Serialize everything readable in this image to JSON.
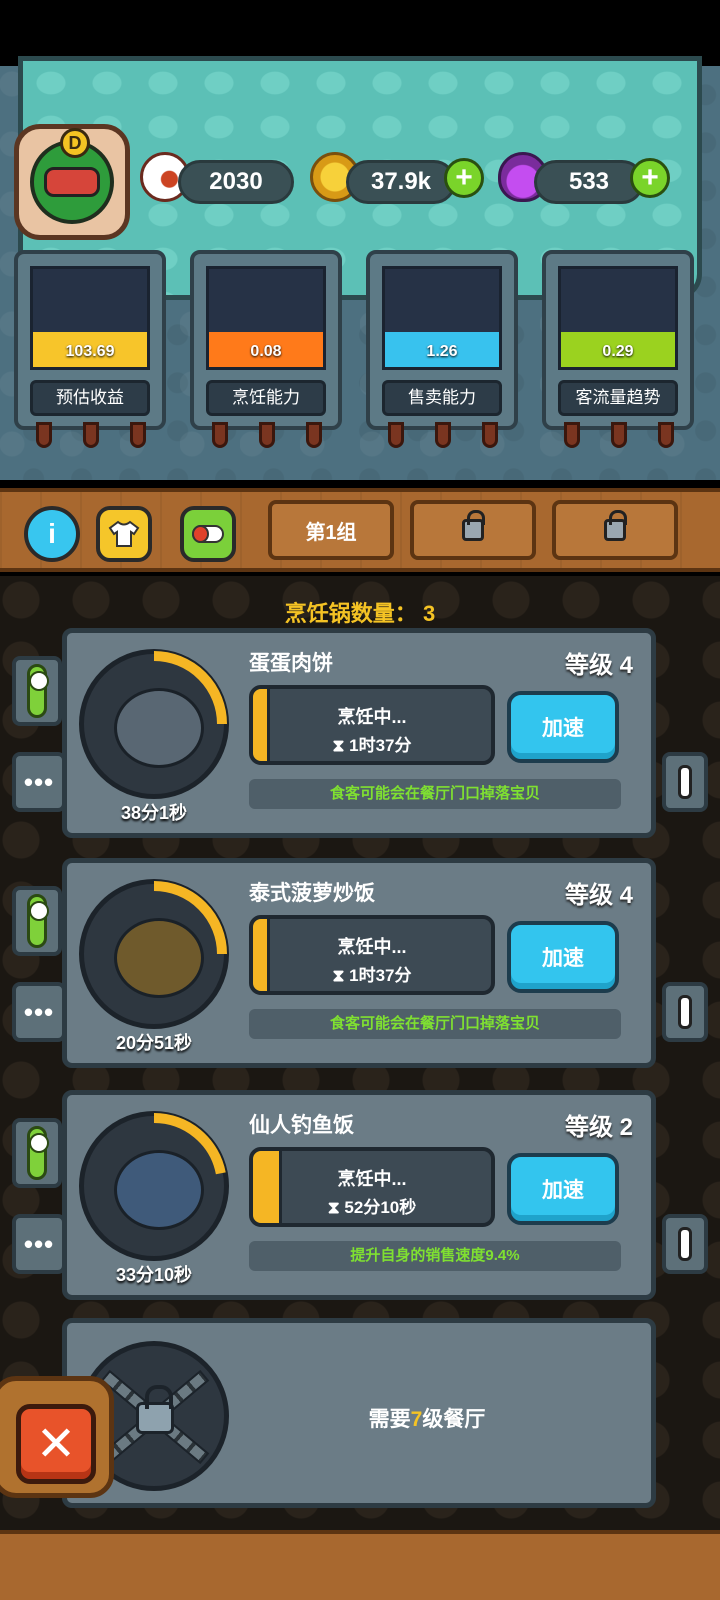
{
  "resources": {
    "eyes": "2030",
    "coins": "37.9k",
    "potions": "533",
    "add_label": "+"
  },
  "avatar": {
    "grade": "D"
  },
  "gauges": [
    {
      "value": "103.69",
      "fill_fraction": 0.36,
      "label": "预估收益",
      "color": "#f7c52a"
    },
    {
      "value": "0.08",
      "fill_fraction": 0.36,
      "label": "烹饪能力",
      "color": "#ff7a1a"
    },
    {
      "value": "1.26",
      "fill_fraction": 0.36,
      "label": "售卖能力",
      "color": "#38c2ee"
    },
    {
      "value": "0.29",
      "fill_fraction": 0.36,
      "label": "客流量趋势",
      "color": "#9bd21f"
    }
  ],
  "toolbar": {
    "info_icon": "info-icon",
    "info_glyph": "i",
    "shirt_icon": "shirt-icon",
    "pill_icon": "pill-icon",
    "group_tab": "第1组"
  },
  "pot_count": {
    "label": "烹饪锅数量：",
    "value": "3"
  },
  "dishes": [
    {
      "name": "蛋蛋肉饼",
      "level": "等级 4",
      "status": "烹饪中...",
      "remaining": "1时37分",
      "timer": "38分1秒",
      "ring_fraction": 0.25,
      "progress_fraction": 0.07,
      "button": "加速",
      "bonus": "食客可能会在餐厅门口掉落宝贝"
    },
    {
      "name": "泰式菠萝炒饭",
      "level": "等级 4",
      "status": "烹饪中...",
      "remaining": "1时37分",
      "timer": "20分51秒",
      "ring_fraction": 0.25,
      "progress_fraction": 0.07,
      "button": "加速",
      "bonus": "食客可能会在餐厅门口掉落宝贝"
    },
    {
      "name": "仙人钓鱼饭",
      "level": "等级 2",
      "status": "烹饪中...",
      "remaining": "52分10秒",
      "timer": "33分10秒",
      "ring_fraction": 0.22,
      "progress_fraction": 0.12,
      "button": "加速",
      "bonus": "提升自身的销售速度9.4%"
    }
  ],
  "locked_slot": {
    "prefix": "需要",
    "level": "7",
    "suffix": "级餐厅"
  },
  "close_label": "✕",
  "side_dots": "•••",
  "hourglass": "⧗"
}
